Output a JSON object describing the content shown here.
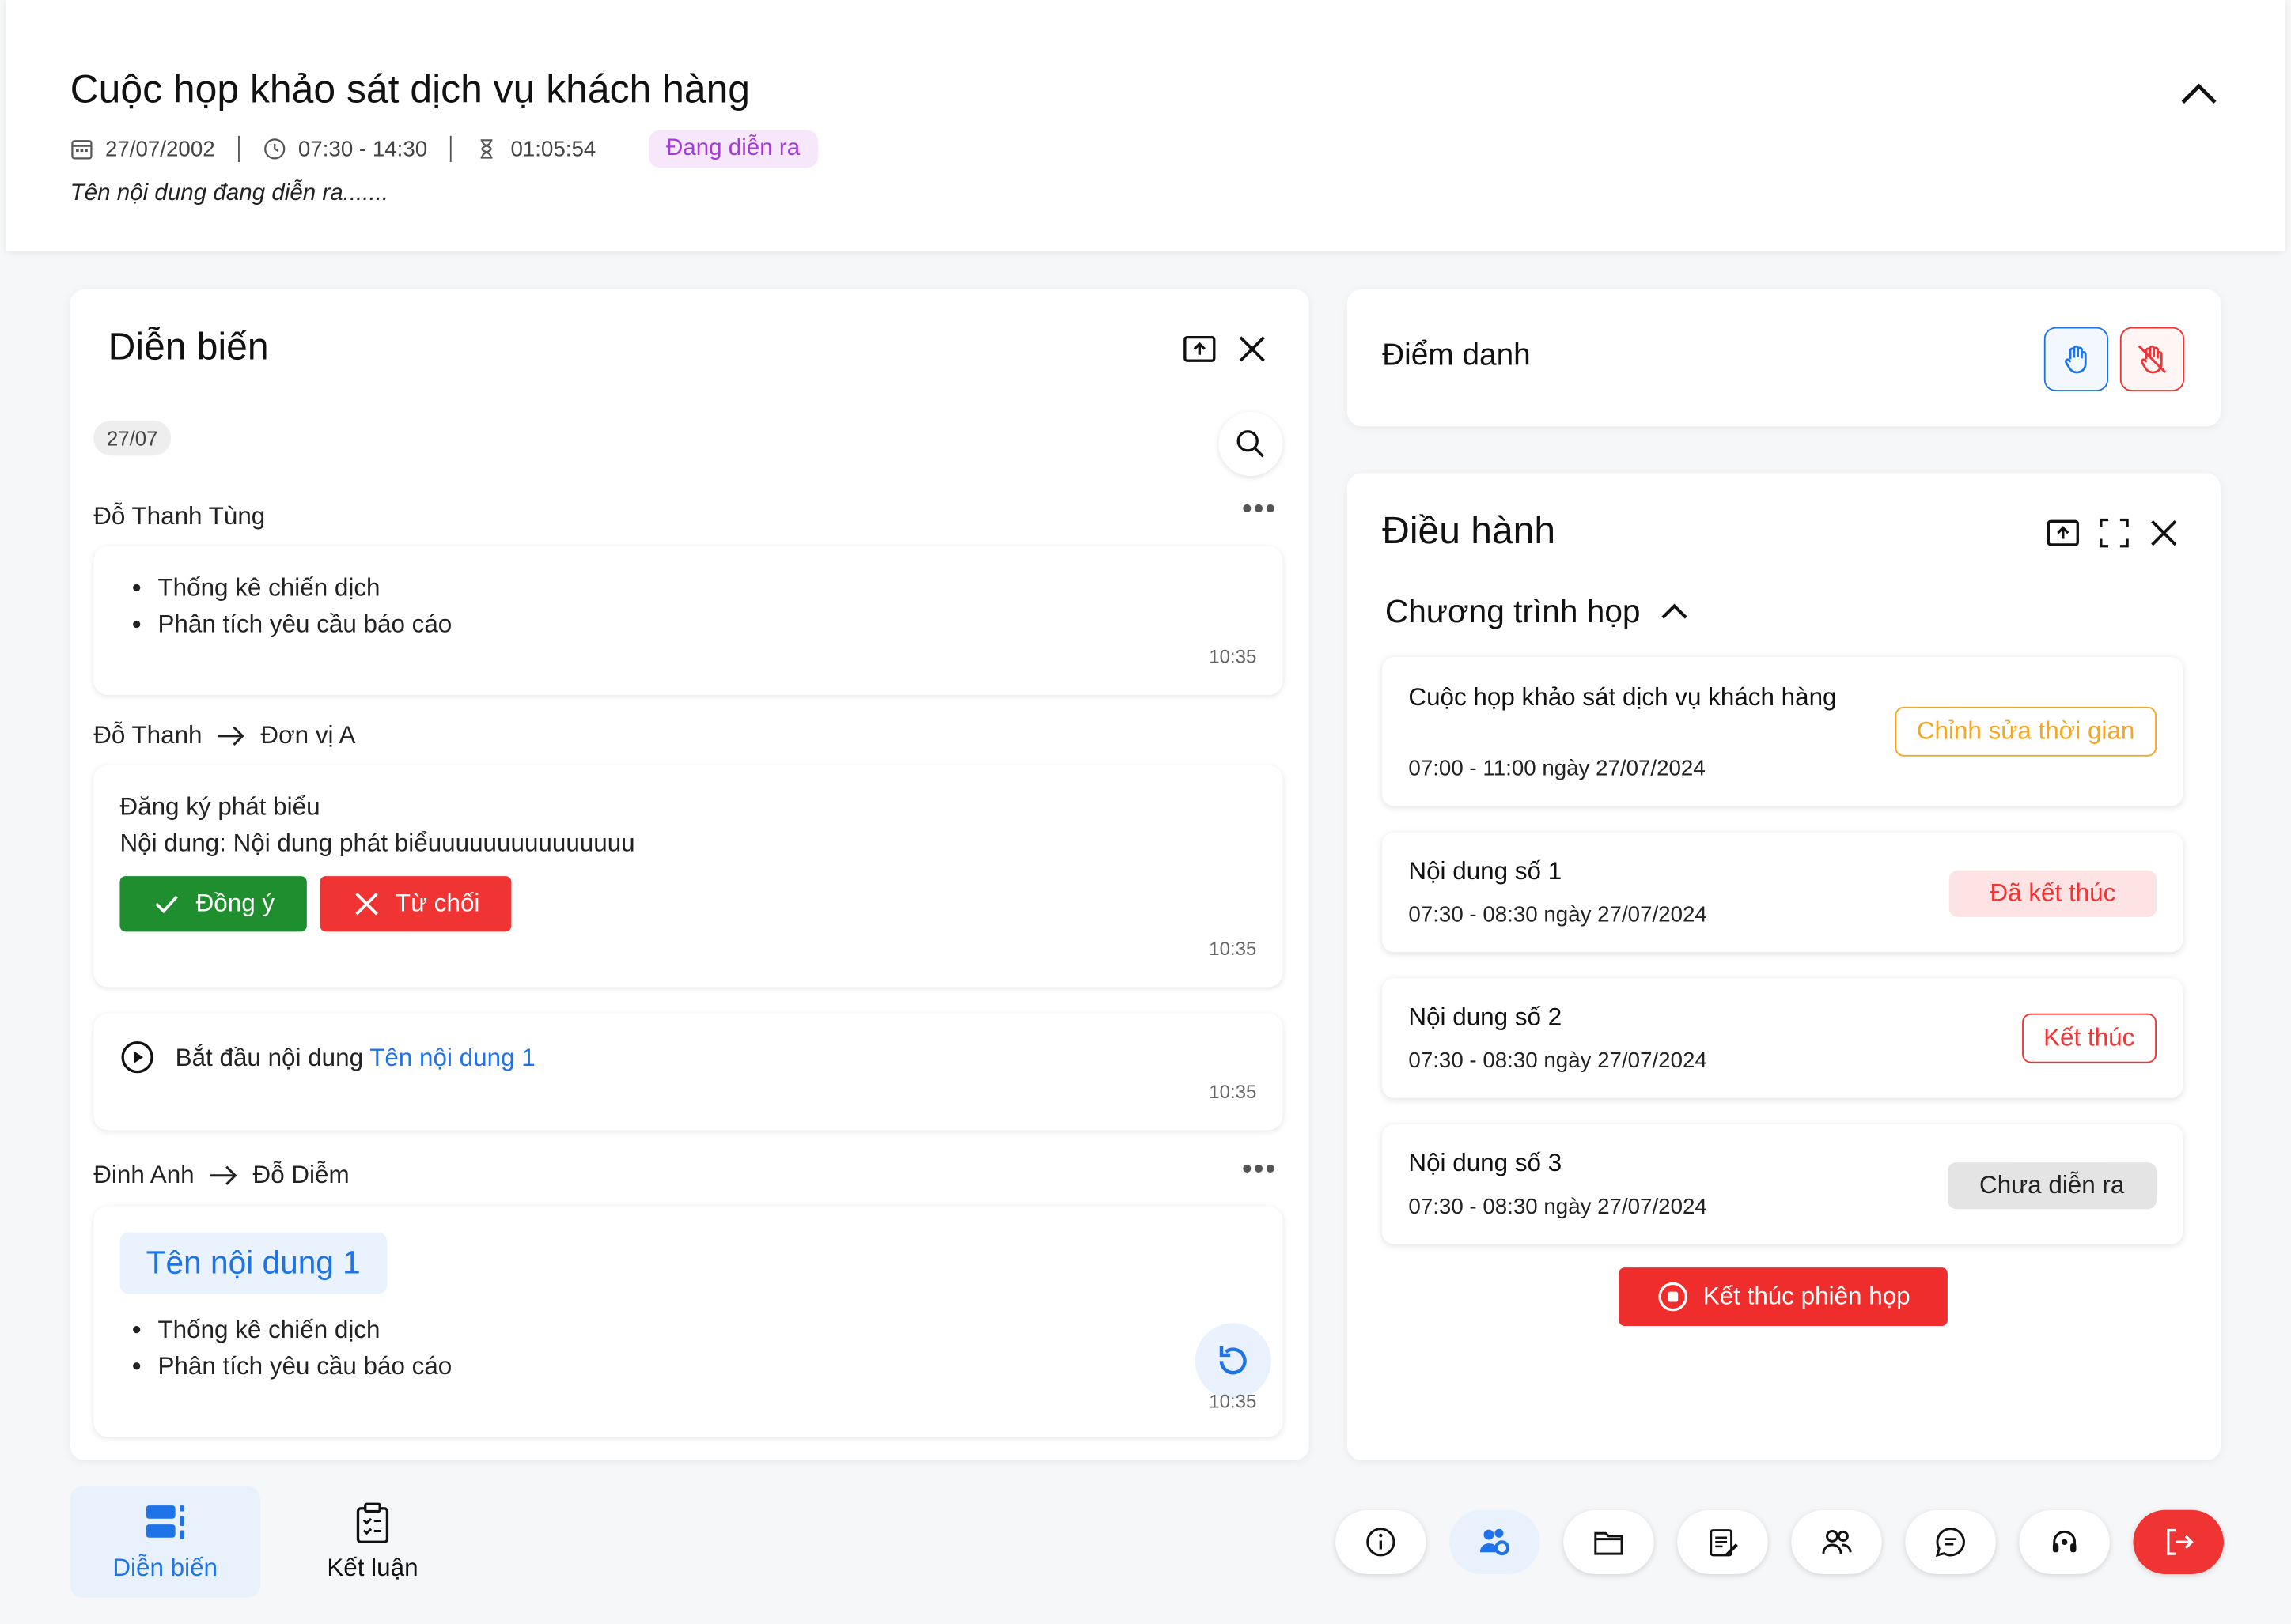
{
  "header": {
    "title": "Cuộc họp khảo sát dịch vụ khách hàng",
    "date": "27/07/2002",
    "time_range": "07:30 - 14:30",
    "elapsed": "01:05:54",
    "status": "Đang diễn ra",
    "current_content": "Tên nội dung đang diễn ra......."
  },
  "feed": {
    "title": "Diễn biến",
    "date_chip": "27/07",
    "entries": [
      {
        "sender": "Đỗ Thanh Tùng",
        "bullets": [
          "Thống kê chiến dịch",
          "Phân tích yêu cầu báo cáo"
        ],
        "time": "10:35"
      },
      {
        "sender": "Đỗ Thanh",
        "recipient": "Đơn vị A",
        "line1": "Đăng ký phát biểu",
        "line2": "Nội dung: Nội dung phát biểuuuuuuuuuuuuuuu",
        "accept": "Đồng ý",
        "reject": "Từ chối",
        "time": "10:35"
      },
      {
        "prefix": "Bắt đầu nội dung",
        "link": "Tên nội dung 1",
        "time": "10:35"
      },
      {
        "sender": "Đinh Anh",
        "recipient": "Đỗ Diễm",
        "chip": "Tên nội dung 1",
        "bullets": [
          "Thống kê chiến dịch",
          "Phân tích yêu cầu báo cáo"
        ],
        "time": "10:35"
      }
    ]
  },
  "attendance": {
    "title": "Điểm danh"
  },
  "control": {
    "title": "Điều hành",
    "agenda_title": "Chương trình họp",
    "items": [
      {
        "name": "Cuộc họp khảo sát dịch vụ khách hàng",
        "when": "07:00 - 11:00 ngày 27/07/2024",
        "action": "Chỉnh sửa thời gian",
        "color": "#f5a623"
      },
      {
        "name": "Nội dung số 1",
        "when": "07:30 - 08:30 ngày 27/07/2024",
        "action": "Đã kết thúc",
        "color": "#f03333"
      },
      {
        "name": "Nội dung số 2",
        "when": "07:30 - 08:30 ngày 27/07/2024",
        "action": "Kết thúc",
        "color": "#f03333"
      },
      {
        "name": "Nội dung số 3",
        "when": "07:30 - 08:30 ngày 27/07/2024",
        "action": "Chưa diễn ra",
        "color": "#222222"
      }
    ],
    "end_session": "Kết thúc phiên họp"
  },
  "bottom_nav": {
    "tabs": [
      "Diễn biến",
      "Kết luận"
    ],
    "tools": [
      "info-icon",
      "users-settings-icon",
      "folder-icon",
      "notes-icon",
      "participants-icon",
      "chat-icon",
      "support-icon",
      "exit-icon"
    ]
  }
}
